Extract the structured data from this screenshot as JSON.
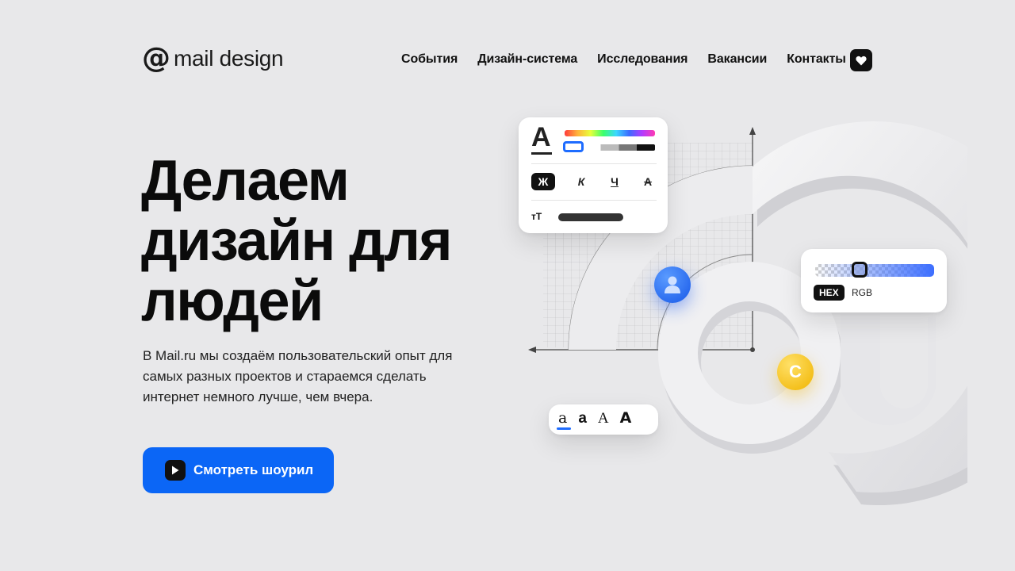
{
  "header": {
    "logo_symbol": "@",
    "logo_text": "mail design",
    "nav": [
      "События",
      "Дизайн-система",
      "Исследования",
      "Вакансии",
      "Контакты"
    ],
    "favorite_icon": "heart-icon"
  },
  "hero": {
    "title_lines": [
      "Делаем",
      "дизайн для",
      "людей"
    ],
    "description": "В Mail.ru мы создаём пользовательский опыт для самых разных проектов и стараемся сделать интернет немного лучше, чем вчера.",
    "cta_label": "Смотреть шоурил",
    "cta_icon": "play-icon"
  },
  "illustration": {
    "text_panel": {
      "glyph": "A",
      "format_buttons": [
        "Ж",
        "К",
        "Ч",
        "А"
      ],
      "size_icon": "тТ"
    },
    "color_panel": {
      "hex_label": "HEX",
      "rgb_label": "RGB"
    },
    "font_panel": {
      "samples": [
        "a",
        "a",
        "A",
        "A"
      ]
    },
    "coin_symbol": "С",
    "user_icon": "user-icon"
  },
  "colors": {
    "background": "#e8e8ea",
    "accent": "#0b66f6",
    "dark": "#111111",
    "coin": "#f0b400"
  }
}
